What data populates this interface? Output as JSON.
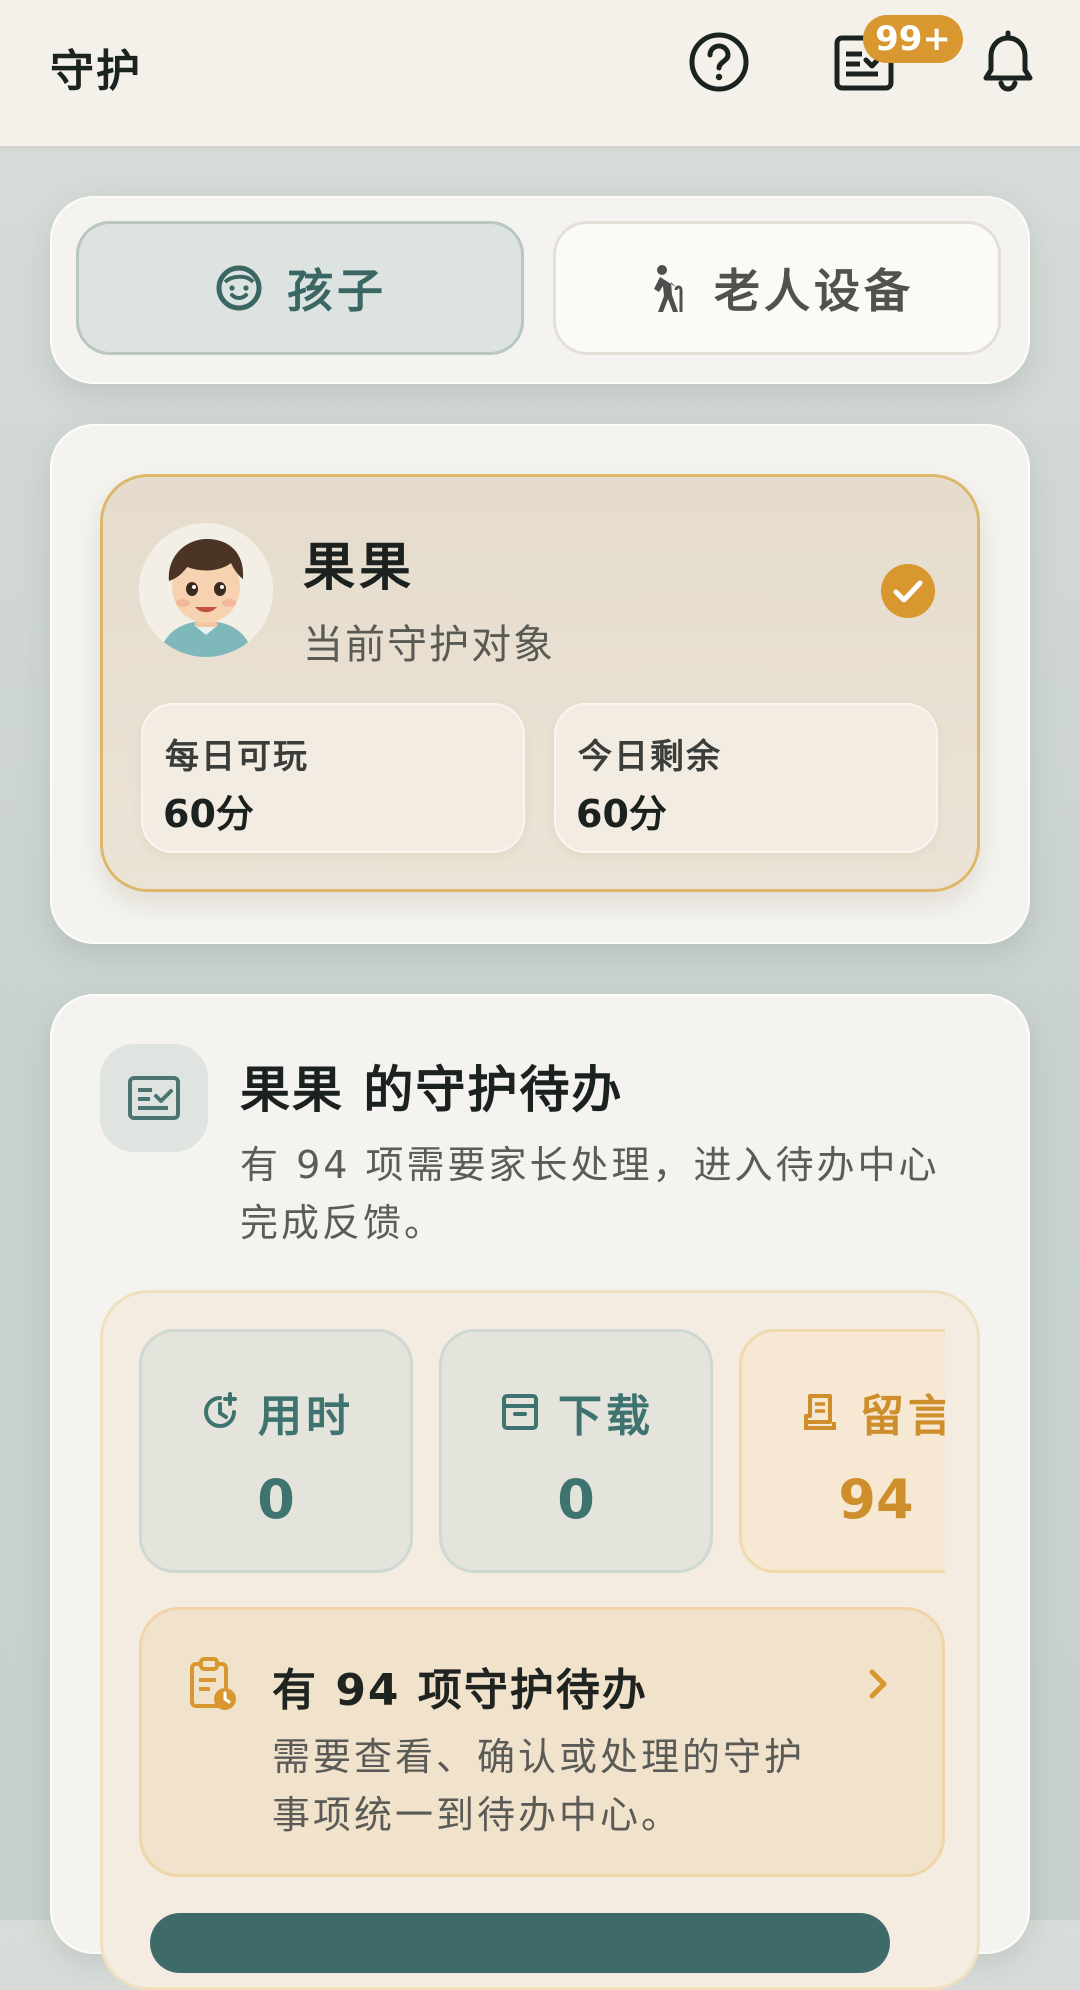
{
  "header": {
    "title": "守护",
    "badge": "99+",
    "icons": [
      "help-icon",
      "task-list-icon",
      "bell-icon"
    ]
  },
  "tabs": [
    {
      "label": "孩子",
      "icon": "child-face-icon",
      "active": true
    },
    {
      "label": "老人设备",
      "icon": "elderly-person-icon",
      "active": false
    }
  ],
  "target": {
    "name": "果果",
    "subtitle": "当前守护对象",
    "avatar": "child-avatar",
    "selected": true,
    "stats": [
      {
        "label": "每日可玩",
        "value": "60分"
      },
      {
        "label": "今日剩余",
        "value": "60分"
      }
    ]
  },
  "todo": {
    "title": "果果 的守护待办",
    "description": "有 94 项需要家长处理，进入待办中心完成反馈。",
    "metrics": [
      {
        "label": "用时",
        "value": "0",
        "icon": "clock-icon"
      },
      {
        "label": "下载",
        "value": "0",
        "icon": "archive-icon"
      },
      {
        "label": "留言",
        "value": "94",
        "icon": "message-icon"
      }
    ],
    "cta": {
      "title": "有 94 项守护待办",
      "description": "需要查看、确认或处理的守护事项统一到待办中心。"
    }
  },
  "colors": {
    "accent_teal": "#3f7370",
    "accent_amber": "#d8972f",
    "background": "#f4f1ea"
  }
}
